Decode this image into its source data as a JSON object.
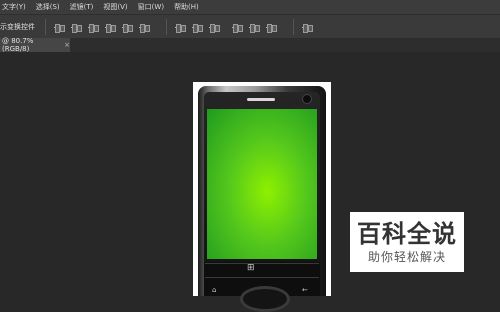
{
  "menubar": {
    "items": [
      "文字(Y)",
      "选择(S)",
      "滤镜(T)",
      "视图(V)",
      "窗口(W)",
      "帮助(H)"
    ]
  },
  "options_bar": {
    "transform_label": "示变换控件"
  },
  "document_tab": {
    "label": "@ 80.7%(RGB/8)",
    "close": "×"
  },
  "watermark": {
    "title": "百科全说",
    "subtitle": "助你轻松解决"
  },
  "phone": {
    "softkey_left": "⌂",
    "softkey_right": "←",
    "windows_logo": "⊞"
  },
  "colors": {
    "background": "#282828",
    "screen_center": "#8ef000",
    "screen_edge": "#1f9a20"
  }
}
